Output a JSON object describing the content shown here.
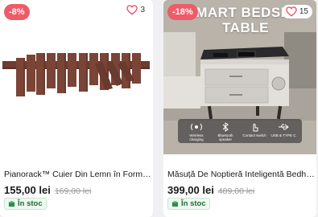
{
  "products": [
    {
      "discount": "-8%",
      "favorites": "3",
      "title": "Pianorack™ Cuier Din Lemn în Form…",
      "price": "155,00 lei",
      "old_price": "169,00 lei",
      "stock": "În stoc"
    },
    {
      "discount": "-18%",
      "favorites": "15",
      "title": "Măsuță De Noptieră Inteligentă Bedh…",
      "price": "399,00 lei",
      "old_price": "489,00 lei",
      "stock": "În stoc",
      "image_text": {
        "line1": "SMART BEDSIDE",
        "line2": "TABLE"
      },
      "features": [
        "Wireless charging",
        "Bluetooth speaker",
        "Contact switch",
        "USB & TYPE C"
      ]
    }
  ],
  "colors": {
    "badge": "#ef5b68",
    "stock_text": "#1d6b34",
    "stock_bg": "#eef9f0"
  }
}
